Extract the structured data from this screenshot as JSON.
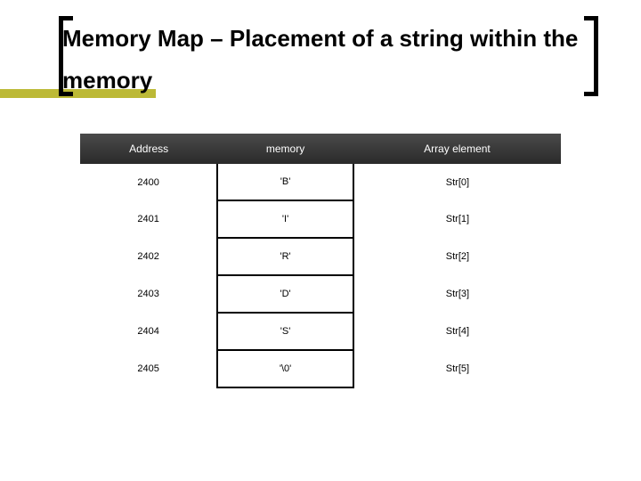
{
  "title": "Memory Map – Placement of a string within the memory",
  "table": {
    "headers": {
      "col0": "Address",
      "col1": "memory",
      "col2": "Array element"
    },
    "rows": [
      {
        "address": "2400",
        "memory": "'B'",
        "element": "Str[0]"
      },
      {
        "address": "2401",
        "memory": "'I'",
        "element": "Str[1]"
      },
      {
        "address": "2402",
        "memory": "'R'",
        "element": "Str[2]"
      },
      {
        "address": "2403",
        "memory": "'D'",
        "element": "Str[3]"
      },
      {
        "address": "2404",
        "memory": "'S'",
        "element": "Str[4]"
      },
      {
        "address": "2405",
        "memory": "'\\0'",
        "element": "Str[5]"
      }
    ]
  }
}
